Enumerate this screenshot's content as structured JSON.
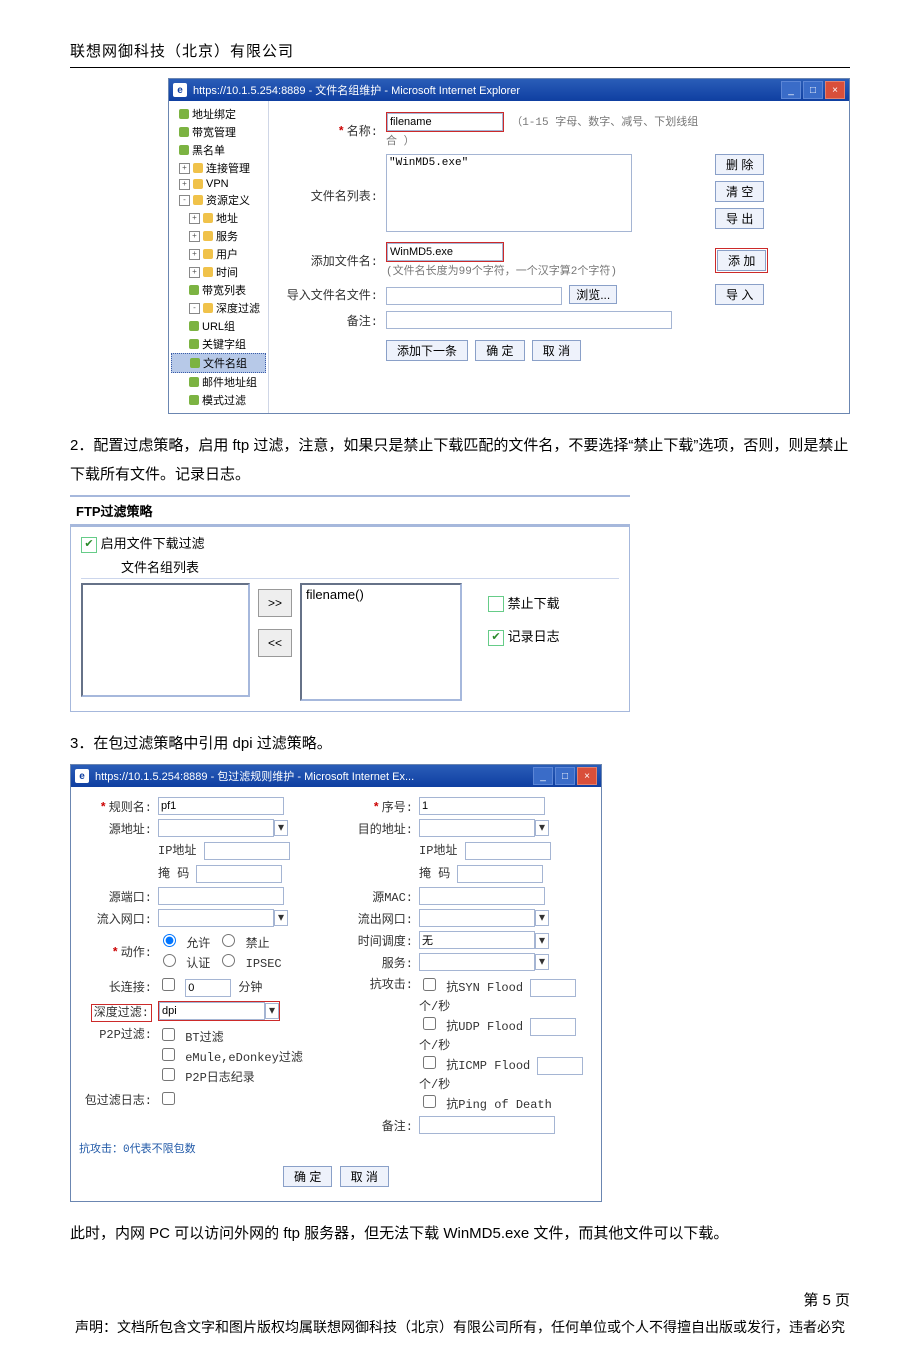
{
  "company": "联想网御科技（北京）有限公司",
  "window1": {
    "title": "https://10.1.5.254:8889 - 文件名组维护 - Microsoft Internet Explorer",
    "tree": [
      {
        "label": "地址绑定",
        "cls": "g"
      },
      {
        "label": "带宽管理",
        "cls": "g"
      },
      {
        "label": "黑名单",
        "cls": "g"
      },
      {
        "label": "连接管理",
        "cls": "y",
        "exp": "+"
      },
      {
        "label": "VPN",
        "cls": "y",
        "exp": "+"
      },
      {
        "label": "资源定义",
        "cls": "y",
        "exp": "-"
      },
      {
        "label": "地址",
        "cls": "y",
        "exp": "+",
        "ind": true
      },
      {
        "label": "服务",
        "cls": "y",
        "exp": "+",
        "ind": true
      },
      {
        "label": "用户",
        "cls": "y",
        "exp": "+",
        "ind": true
      },
      {
        "label": "时间",
        "cls": "y",
        "exp": "+",
        "ind": true
      },
      {
        "label": "带宽列表",
        "cls": "g",
        "ind": true
      },
      {
        "label": "深度过滤",
        "cls": "y",
        "exp": "-",
        "ind": true
      },
      {
        "label": "URL组",
        "cls": "g",
        "ind": true
      },
      {
        "label": "关键字组",
        "cls": "g",
        "ind": true
      },
      {
        "label": "文件名组",
        "cls": "g",
        "ind": true,
        "sel": true
      },
      {
        "label": "邮件地址组",
        "cls": "g",
        "ind": true
      },
      {
        "label": "模式过滤",
        "cls": "g",
        "ind": true
      }
    ],
    "labels": {
      "name": "名称:",
      "nameHint": "（1-15 字母、数字、减号、下划线组合 ）",
      "filelist": "文件名列表:",
      "addfile": "添加文件名:",
      "addHint": "(文件名长度为99个字符，一个汉字算2个字符)",
      "importfile": "导入文件名文件:",
      "remark": "备注:"
    },
    "values": {
      "name": "filename",
      "list": "\"WinMD5.exe\"",
      "add": "WinMD5.exe"
    },
    "buttons": {
      "del": "删 除",
      "clear": "清 空",
      "export": "导 出",
      "add": "添 加",
      "browse": "浏览...",
      "import": "导 入",
      "addnext": "添加下一条",
      "ok": "确 定",
      "cancel": "取 消"
    }
  },
  "para2": "2．配置过虑策略，启用 ftp 过滤，注意，如果只是禁止下载匹配的文件名，不要选择“禁止下载”选项，否则，则是禁止下载所有文件。记录日志。",
  "ftp": {
    "title": "FTP过滤策略",
    "enable": "启用文件下载过滤",
    "listTitle": "文件名组列表",
    "selected": "filename()",
    "forbid": "禁止下载",
    "log": "记录日志",
    "btnRight": ">>",
    "btnLeft": "<<"
  },
  "para3": "3．在包过滤策略中引用 dpi 过滤策略。",
  "window2": {
    "title": "https://10.1.5.254:8889 - 包过滤规则维护 - Microsoft Internet Ex...",
    "labels": {
      "rule": "规则名:",
      "seq": "序号:",
      "src": "源地址:",
      "dst": "目的地址:",
      "ip": "IP地址",
      "mask": "掩  码",
      "sport": "源端口:",
      "smac": "源MAC:",
      "inif": "流入网口:",
      "outif": "流出网口:",
      "action": "动作:",
      "time": "时间调度:",
      "service": "服务:",
      "long": "长连接:",
      "minute": "分钟",
      "dpi": "深度过滤:",
      "anti": "抗攻击:",
      "p2p": "P2P过滤:",
      "log": "包过滤日志:",
      "remark": "备注:",
      "allow": "允许",
      "deny": "禁止",
      "auth": "认证",
      "ipsec": "IPSEC",
      "bt": "BT过滤",
      "emule": "eMule,eDonkey过滤",
      "p2plog": "P2P日志纪录",
      "syn": "抗SYN  Flood",
      "udp": "抗UDP  Flood",
      "icmp": "抗ICMP Flood",
      "ping": "抗Ping of Death",
      "perSec": "个/秒"
    },
    "values": {
      "rule": "pf1",
      "seq": "1",
      "time": "无",
      "dpi": "dpi",
      "long": "0"
    },
    "note": "抗攻击：0代表不限包数",
    "ok": "确 定",
    "cancel": "取 消"
  },
  "para4": "此时，内网 PC 可以访问外网的 ftp 服务器，但无法下载 WinMD5.exe 文件，而其他文件可以下载。",
  "footerPage": "第 5 页",
  "disclaimer": "声明：文档所包含文字和图片版权均属联想网御科技（北京）有限公司所有，任何单位或个人不得擅自出版或发行，违者必究"
}
